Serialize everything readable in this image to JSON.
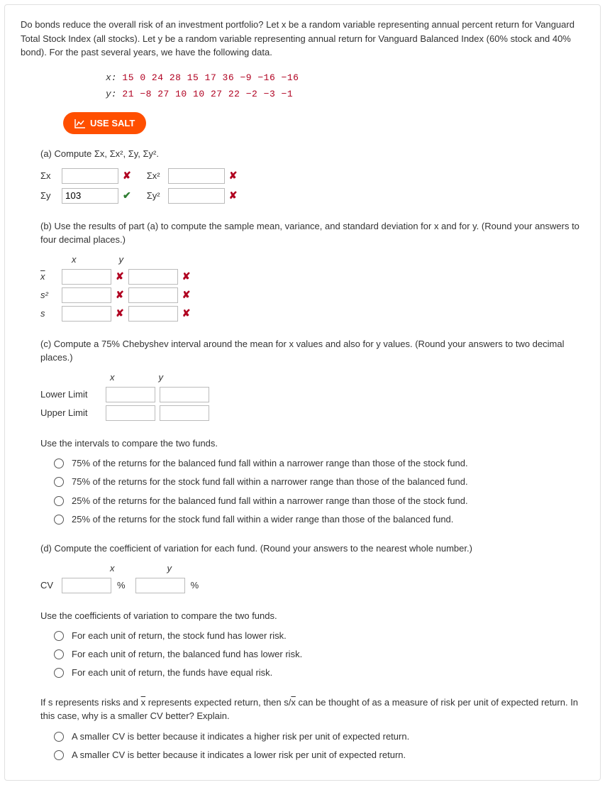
{
  "intro": "Do bonds reduce the overall risk of an investment portfolio? Let x be a random variable representing annual percent return for Vanguard Total Stock Index (all stocks). Let y be a random variable representing annual return for Vanguard Balanced Index (60% stock and 40% bond). For the past several years, we have the following data.",
  "data_rows": {
    "x_label": "x:",
    "x_values": "15  0    24  28  15  17  36  −9  −16  −16",
    "y_label": "y:",
    "y_values": "21  −8  27  10  10  27  22  −2  −3    −1"
  },
  "salt_label": "USE SALT",
  "part_a": {
    "prompt": "(a) Compute Σx, Σx², Σy, Σy².",
    "sx": "Σx",
    "sx2": "Σx²",
    "sy": "Σy",
    "sy2": "Σy²",
    "sy_value": "103"
  },
  "part_b": {
    "prompt": "(b) Use the results of part (a) to compute the sample mean, variance, and standard deviation for x and for y. (Round your answers to four decimal places.)",
    "hx": "x",
    "hy": "y",
    "r1": "x",
    "r2": "s²",
    "r3": "s"
  },
  "part_c": {
    "prompt": "(c) Compute a 75% Chebyshev interval around the mean for x values and also for y values. (Round your answers to two decimal places.)",
    "hx": "x",
    "hy": "y",
    "ll": "Lower Limit",
    "ul": "Upper Limit"
  },
  "compare_intervals": {
    "prompt": "Use the intervals to compare the two funds.",
    "opts": [
      "75% of the returns for the balanced fund fall within a narrower range than those of the stock fund.",
      "75% of the returns for the stock fund fall within a narrower range than those of the balanced fund.",
      "25% of the returns for the balanced fund fall within a narrower range than those of the stock fund.",
      "25% of the returns for the stock fund fall within a wider range than those of the balanced fund."
    ]
  },
  "part_d": {
    "prompt": "(d) Compute the coefficient of variation for each fund. (Round your answers to the nearest whole number.)",
    "hx": "x",
    "hy": "y",
    "cv": "CV",
    "pct": "%"
  },
  "compare_cv": {
    "prompt": "Use the coefficients of variation to compare the two funds.",
    "opts": [
      "For each unit of return, the stock fund has lower risk.",
      "For each unit of return, the balanced fund has lower risk.",
      "For each unit of return, the funds have equal risk."
    ]
  },
  "explain_cv": {
    "prompt_pre": "If s represents risks and ",
    "prompt_mid": " represents expected return, then s/",
    "prompt_post": " can be thought of as a measure of risk per unit of expected return. In this case, why is a smaller CV better? Explain.",
    "xbar": "x",
    "opts": [
      "A smaller CV is better because it indicates a higher risk per unit of expected return.",
      "A smaller CV is better because it indicates a lower risk per unit of expected return."
    ]
  }
}
